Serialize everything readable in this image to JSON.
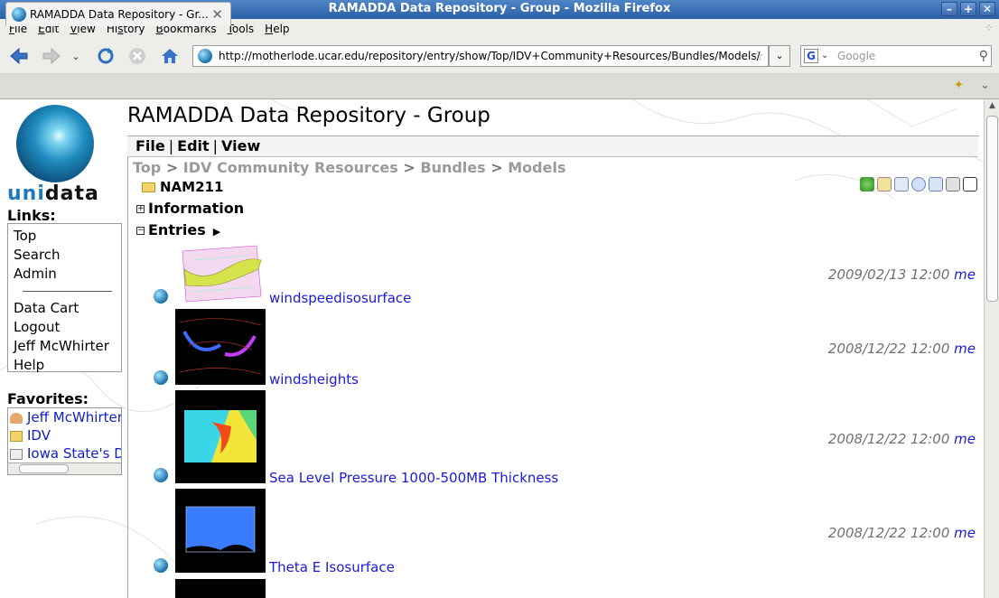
{
  "window": {
    "title": "RAMADDA Data Repository - Group - Mozilla Firefox",
    "controls": [
      "–",
      "+",
      "✕"
    ]
  },
  "menu": [
    {
      "label": "File",
      "key": "F",
      "rest": "ile"
    },
    {
      "label": "Edit",
      "key": "E",
      "rest": "dit"
    },
    {
      "label": "View",
      "key": "V",
      "rest": "iew"
    },
    {
      "label": "History",
      "key": "s",
      "pre": "Hi",
      "rest": "tory"
    },
    {
      "label": "Bookmarks",
      "key": "B",
      "rest": "ookmarks"
    },
    {
      "label": "Tools",
      "key": "T",
      "rest": "ools"
    },
    {
      "label": "Help",
      "key": "H",
      "rest": "elp"
    }
  ],
  "nav": {
    "url": "http://motherlode.ucar.edu/repository/entry/show/Top/IDV+Community+Resources/Bundles/Models/",
    "search_placeholder": "Google"
  },
  "tab": {
    "label": "RAMADDA Data Repository - Gr..."
  },
  "sidebar": {
    "links_label": "Links:",
    "links": [
      "Top",
      "Search",
      "Admin"
    ],
    "links2": [
      "Data Cart",
      "Logout",
      "Jeff McWhirter",
      "Help"
    ],
    "favorites_label": "Favorites:",
    "favorites": [
      "Jeff McWhirter",
      "IDV",
      "Iowa State's D"
    ]
  },
  "page": {
    "title": "RAMADDA Data Repository - Group",
    "repo_menu": [
      "File",
      "Edit",
      "View"
    ],
    "breadcrumb": [
      "Top",
      "IDV Community Resources",
      "Bundles",
      "Models"
    ],
    "folder": "NAM211",
    "sections": {
      "information": "Information",
      "entries": "Entries"
    }
  },
  "entries": [
    {
      "name": "windspeedisosurface",
      "date": "2009/02/13 12:00",
      "user": "me"
    },
    {
      "name": "windsheights",
      "date": "2008/12/22 12:00",
      "user": "me"
    },
    {
      "name": "Sea Level Pressure 1000-500MB Thickness",
      "date": "2008/12/22 12:00",
      "user": "me"
    },
    {
      "name": "Theta E Isosurface",
      "date": "2008/12/22 12:00",
      "user": "me"
    }
  ],
  "colors": {
    "link": "#1a1adc",
    "titlebar": "#2a5ea6",
    "breadcrumb": "#9a9a9a"
  }
}
